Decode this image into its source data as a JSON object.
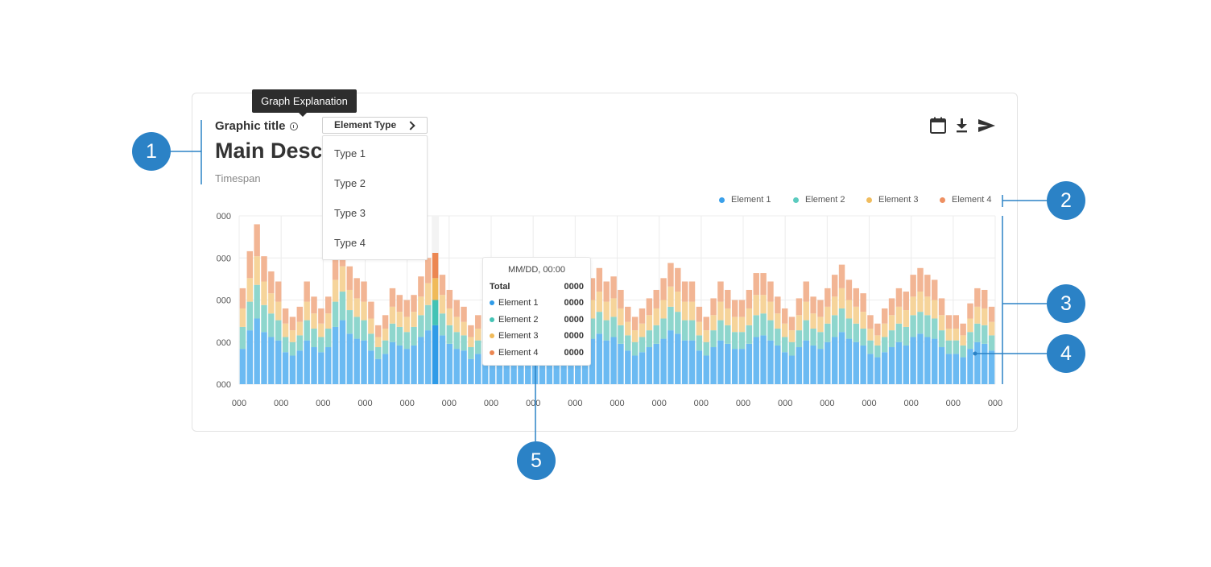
{
  "header": {
    "graphic_title": "Graphic title",
    "tooltip": "Graph Explanation",
    "main_description": "Main Desc",
    "timespan": "Timespan",
    "select_label": "Element Type"
  },
  "dropdown": {
    "options": [
      "Type 1",
      "Type 2",
      "Type 3",
      "Type 4"
    ]
  },
  "toolbar": {
    "icons": [
      "calendar-icon",
      "download-icon",
      "send-icon"
    ]
  },
  "callouts": [
    "1",
    "2",
    "3",
    "4",
    "5"
  ],
  "colors": {
    "element1": "#6bbaf2",
    "element2": "#8ed6cd",
    "element3": "#f6d49a",
    "element4": "#f2b594",
    "element1_dot": "#3aa0ea",
    "element2_dot": "#5ccbbf",
    "element3_dot": "#f0bc5e",
    "element4_dot": "#ee9062",
    "callout": "#2b82c6",
    "highlight": [
      "#2f9be8",
      "#44c3b5",
      "#f0ba59",
      "#ec8752"
    ]
  },
  "tooltip": {
    "header": "MM/DD, 00:00",
    "rows": [
      {
        "label": "Total",
        "value": "0000"
      },
      {
        "label": "Element 1",
        "value": "0000"
      },
      {
        "label": "Element 2",
        "value": "0000"
      },
      {
        "label": "Element 3",
        "value": "0000"
      },
      {
        "label": "Element 4",
        "value": "0000"
      }
    ]
  },
  "chart_data": {
    "type": "bar",
    "stacked": true,
    "legend_position": "top-right",
    "grid": true,
    "y_tick_labels": [
      "000",
      "000",
      "000",
      "000",
      "000"
    ],
    "x_tick_labels": [
      "000",
      "000",
      "000",
      "000",
      "000",
      "000",
      "000",
      "000",
      "000",
      "000",
      "000",
      "000",
      "000",
      "000",
      "000",
      "000",
      "000",
      "000",
      "000"
    ],
    "highlight_index": 27,
    "series": [
      {
        "name": "Element 1",
        "values": [
          21,
          32,
          39,
          31,
          28,
          26,
          19,
          17,
          20,
          26,
          22,
          19,
          22,
          34,
          38,
          30,
          27,
          26,
          20,
          15,
          18,
          25,
          23,
          21,
          23,
          28,
          32,
          35,
          29,
          24,
          21,
          20,
          15,
          18,
          21,
          19,
          21,
          25,
          30,
          25,
          29,
          26,
          21,
          20,
          16,
          18,
          21,
          19,
          22,
          27,
          30,
          26,
          28,
          24,
          20,
          17,
          19,
          22,
          24,
          27,
          32,
          30,
          26,
          26,
          20,
          17,
          22,
          26,
          24,
          21,
          21,
          24,
          28,
          29,
          26,
          23,
          19,
          17,
          22,
          26,
          23,
          21,
          25,
          28,
          31,
          27,
          25,
          23,
          18,
          16,
          19,
          22,
          25,
          23,
          28,
          30,
          28,
          27,
          22,
          18,
          18,
          16,
          21,
          25,
          24,
          20
        ]
      },
      {
        "name": "Element 2",
        "values": [
          13,
          17,
          20,
          16,
          14,
          12,
          9,
          8,
          9,
          12,
          11,
          9,
          11,
          15,
          17,
          14,
          13,
          12,
          10,
          7,
          8,
          11,
          11,
          10,
          11,
          13,
          15,
          15,
          13,
          11,
          10,
          9,
          7,
          8,
          10,
          9,
          10,
          11,
          13,
          11,
          13,
          12,
          10,
          9,
          7,
          8,
          10,
          9,
          10,
          12,
          13,
          12,
          12,
          11,
          9,
          8,
          9,
          10,
          11,
          12,
          14,
          13,
          12,
          12,
          9,
          8,
          10,
          12,
          11,
          10,
          10,
          11,
          13,
          13,
          12,
          10,
          9,
          8,
          10,
          12,
          10,
          10,
          11,
          13,
          14,
          12,
          11,
          10,
          8,
          7,
          9,
          10,
          11,
          11,
          13,
          13,
          13,
          12,
          10,
          8,
          8,
          7,
          10,
          11,
          11,
          9
        ]
      },
      {
        "name": "Element 3",
        "values": [
          11,
          14,
          17,
          14,
          12,
          11,
          8,
          7,
          8,
          11,
          9,
          8,
          9,
          13,
          15,
          12,
          11,
          11,
          9,
          6,
          7,
          10,
          9,
          9,
          9,
          11,
          13,
          13,
          11,
          10,
          9,
          8,
          6,
          7,
          8,
          8,
          9,
          10,
          11,
          10,
          12,
          11,
          9,
          8,
          6,
          7,
          9,
          8,
          9,
          11,
          12,
          11,
          11,
          10,
          8,
          7,
          8,
          9,
          10,
          11,
          12,
          12,
          11,
          11,
          8,
          7,
          9,
          11,
          10,
          9,
          9,
          10,
          12,
          11,
          11,
          9,
          8,
          7,
          9,
          11,
          9,
          9,
          10,
          11,
          12,
          11,
          10,
          10,
          7,
          6,
          8,
          9,
          10,
          10,
          11,
          12,
          11,
          11,
          9,
          7,
          7,
          6,
          8,
          10,
          10,
          8
        ]
      },
      {
        "name": "Element 4",
        "values": [
          12,
          16,
          19,
          15,
          13,
          12,
          9,
          8,
          9,
          12,
          10,
          9,
          10,
          15,
          17,
          14,
          12,
          12,
          10,
          7,
          8,
          11,
          10,
          10,
          10,
          12,
          15,
          15,
          12,
          11,
          10,
          9,
          7,
          8,
          9,
          9,
          10,
          11,
          13,
          11,
          13,
          12,
          10,
          9,
          7,
          8,
          10,
          9,
          10,
          13,
          14,
          12,
          13,
          11,
          9,
          8,
          9,
          10,
          11,
          13,
          14,
          14,
          12,
          12,
          9,
          8,
          10,
          12,
          11,
          10,
          10,
          11,
          13,
          13,
          12,
          10,
          9,
          8,
          10,
          12,
          10,
          10,
          11,
          13,
          14,
          12,
          11,
          11,
          8,
          7,
          9,
          10,
          11,
          11,
          13,
          14,
          13,
          12,
          10,
          8,
          8,
          7,
          9,
          11,
          11,
          9
        ]
      }
    ]
  }
}
